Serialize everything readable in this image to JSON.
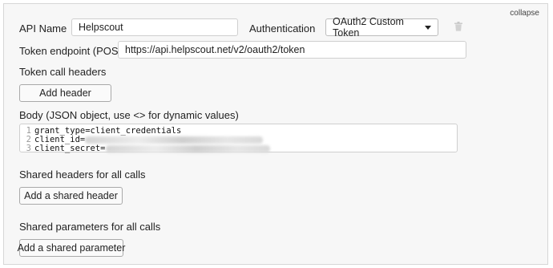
{
  "header": {
    "collapse_label": "collapse"
  },
  "api_name": {
    "label": "API Name",
    "value": "Helpscout"
  },
  "authentication": {
    "label": "Authentication",
    "selected": "OAuth2 Custom Token",
    "delete_icon": "trash-icon"
  },
  "token_endpoint": {
    "label": "Token endpoint (POST)",
    "value": "https://api.helpscout.net/v2/oauth2/token"
  },
  "token_call_headers": {
    "label": "Token call headers",
    "button": "Add header"
  },
  "body": {
    "label": "Body (JSON object, use <> for dynamic values)",
    "lines": [
      {
        "num": "1",
        "text": "grant_type=client_credentials"
      },
      {
        "num": "2",
        "text": "client_id="
      },
      {
        "num": "3",
        "text": "client_secret="
      }
    ]
  },
  "shared_headers": {
    "label": "Shared headers for all calls",
    "button": "Add a shared header"
  },
  "shared_parameters": {
    "label": "Shared parameters for all calls",
    "button": "Add a shared parameter"
  }
}
